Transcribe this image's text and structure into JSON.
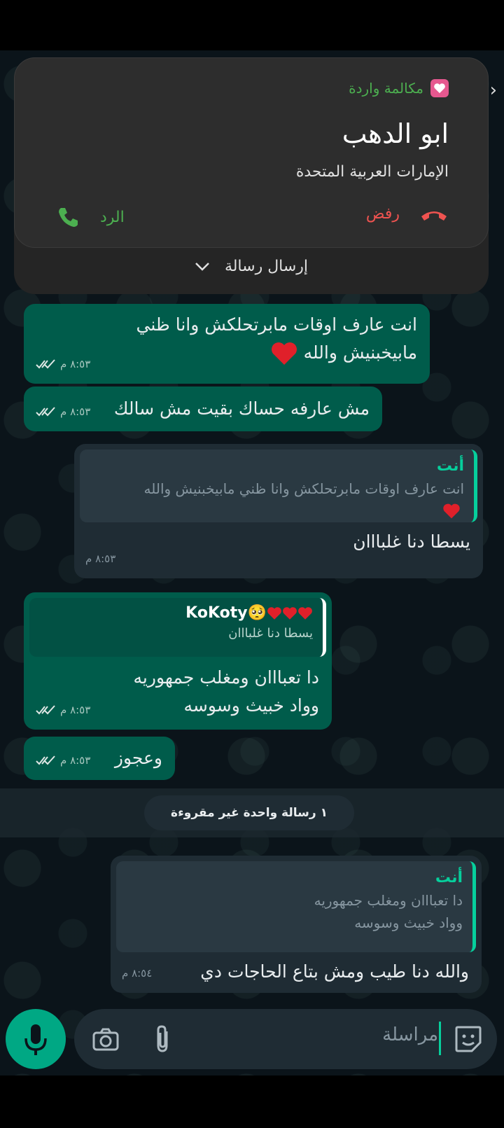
{
  "notification": {
    "app_name": "مكالمة واردة",
    "caller_name": "ابو الدهب",
    "caller_country": "الإمارات العربية المتحدة",
    "decline_label": "رفض",
    "answer_label": "الرد",
    "send_message_label": "إرسال رسالة"
  },
  "messages": [
    {
      "direction": "out",
      "text_line1": "انت عارف اوقات مابرتحلكش وانا ظني",
      "text_line2": "مابيخبنيش والله",
      "emoji": "heart",
      "time": "٨:٥٣ م",
      "ticks": "read"
    },
    {
      "direction": "out",
      "text": "مش عارفه حساك بقيت مش سالك",
      "time": "٨:٥٣ م",
      "ticks": "read"
    },
    {
      "direction": "in",
      "quote_author": "أنت",
      "quote_text": "انت عارف اوقات مابرتحلكش وانا ظني مابيخبنيش والله",
      "quote_emoji": "heart",
      "text": "يسطا دنا غلبااان",
      "time": "٨:٥٣ م"
    },
    {
      "direction": "out",
      "quote_author": "KoKoty",
      "quote_author_emoji": "pleading-face-3-hearts",
      "quote_text": "يسطا دنا غلبااان",
      "text_line1": "دا تعبااان ومغلب جمهوريه",
      "text_line2": "وواد خبيث وسوسه",
      "time": "٨:٥٣ م",
      "ticks": "read"
    },
    {
      "direction": "out",
      "text": "وعجوز",
      "time": "٨:٥٣ م",
      "ticks": "read"
    },
    {
      "direction": "in",
      "quote_author": "أنت",
      "quote_text_line1": "دا تعبااان ومغلب جمهوريه",
      "quote_text_line2": "وواد خبيث وسوسه",
      "text": "والله دنا طيب ومش بتاع الحاجات دي",
      "time": "٨:٥٤ م"
    }
  ],
  "unread_banner": "١ رسالة واحدة غير مقروءة",
  "composer": {
    "placeholder": "مراسلة"
  },
  "colors": {
    "outgoing_bubble": "#005c4b",
    "incoming_bubble": "#1f2c34",
    "accent": "#00a884",
    "decline": "#ef5350",
    "answer": "#4caf50"
  }
}
